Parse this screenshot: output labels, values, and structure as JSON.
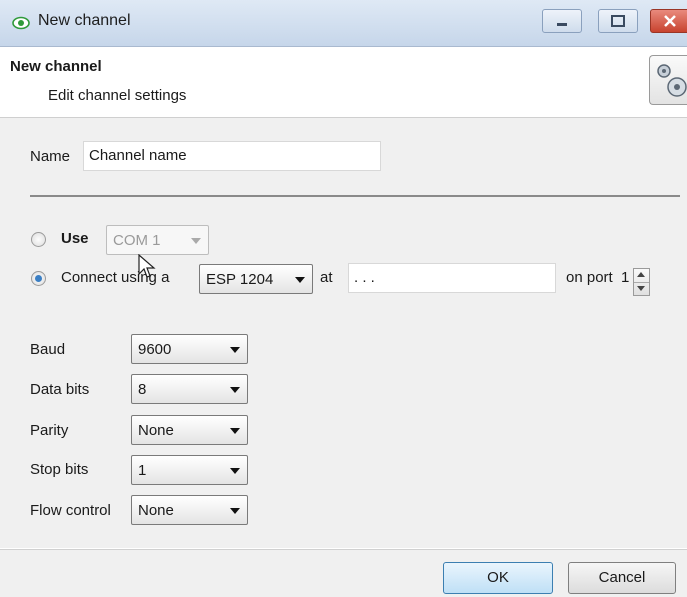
{
  "window": {
    "title": "New channel"
  },
  "header": {
    "title": "New channel",
    "subtitle": "Edit channel settings",
    "icon": "gear-icon"
  },
  "form": {
    "name_label": "Name",
    "name_value": "Channel name",
    "use_label": "Use",
    "use_selected": "COM 1",
    "connect_label": "Connect using a",
    "connect_selected": "ESP 1204",
    "at_label": "at",
    "ip_value": ".   .   .",
    "port_label": "on port",
    "port_value": "1",
    "selected_mode": "connect",
    "baud_label": "Baud",
    "baud_value": "9600",
    "data_bits_label": "Data bits",
    "data_bits_value": "8",
    "parity_label": "Parity",
    "parity_value": "None",
    "stop_bits_label": "Stop bits",
    "stop_bits_value": "1",
    "flow_control_label": "Flow control",
    "flow_control_value": "None"
  },
  "footer": {
    "ok_label": "OK",
    "cancel_label": "Cancel"
  },
  "colors": {
    "titlebar": "#c6d6ea",
    "close_button": "#c8432f",
    "accent": "#3b7fc4"
  }
}
